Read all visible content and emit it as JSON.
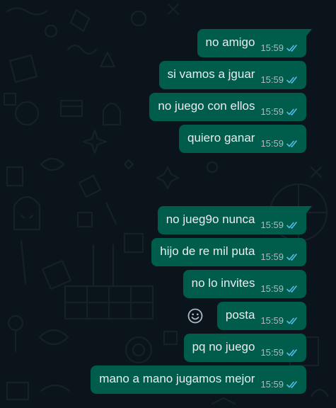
{
  "messages": [
    {
      "text": "no amigo",
      "time": "15:59",
      "status": "read",
      "tail": true
    },
    {
      "text": "si vamos a jguar",
      "time": "15:59",
      "status": "read"
    },
    {
      "text": "no juego con ellos",
      "time": "15:59",
      "status": "read"
    },
    {
      "text": "quiero ganar",
      "time": "15:59",
      "status": "read"
    },
    {
      "text": "no jueg9o nunca",
      "time": "15:59",
      "status": "read",
      "tail": true
    },
    {
      "text": "hijo de re mil puta",
      "time": "15:59",
      "status": "read"
    },
    {
      "text": "no lo invites",
      "time": "15:59",
      "status": "read"
    },
    {
      "text": "posta",
      "time": "15:59",
      "status": "read"
    },
    {
      "text": "pq no juego",
      "time": "15:59",
      "status": "read"
    },
    {
      "text": "mano a mano jugamos mejor",
      "time": "15:59",
      "status": "read"
    }
  ],
  "colors": {
    "background": "#0b141a",
    "outgoing_bubble": "#005c4b",
    "message_text": "#e9edef",
    "timestamp": "#aebac1",
    "read_ticks": "#53bdeb"
  },
  "icons": {
    "reaction": "smiley-face-icon",
    "read_receipt": "double-check-icon"
  }
}
